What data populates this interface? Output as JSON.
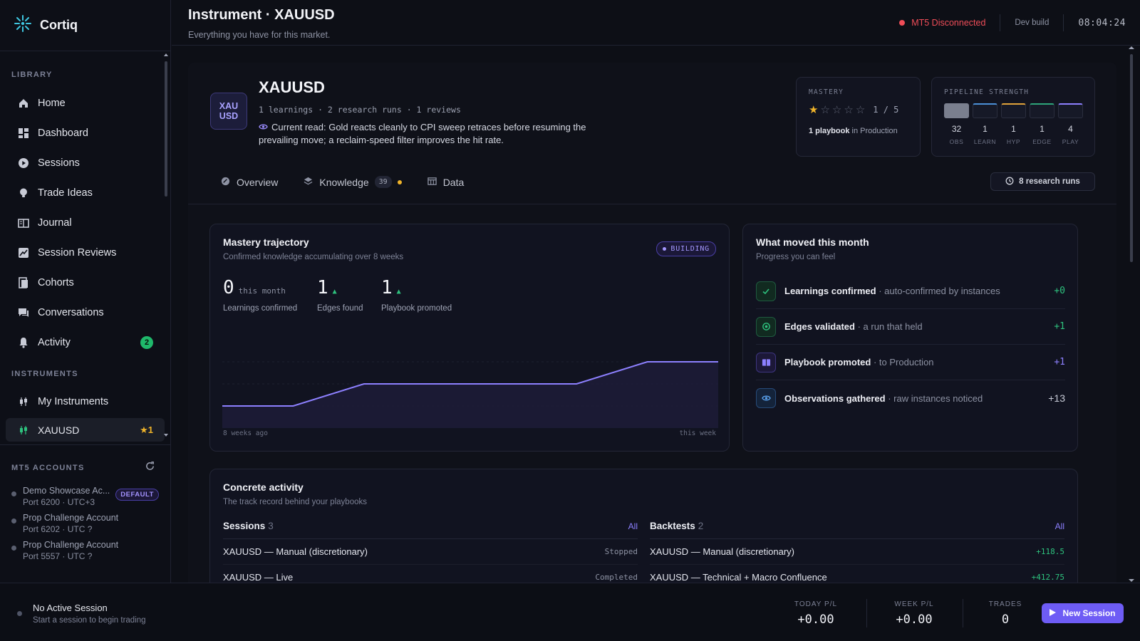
{
  "brand": {
    "name": "Cortiq"
  },
  "sidebar": {
    "library_label": "LIBRARY",
    "items": [
      {
        "label": "Home",
        "icon": "home-icon"
      },
      {
        "label": "Dashboard",
        "icon": "dashboard-icon"
      },
      {
        "label": "Sessions",
        "icon": "play-circle-icon"
      },
      {
        "label": "Trade Ideas",
        "icon": "lightbulb-icon"
      },
      {
        "label": "Journal",
        "icon": "book-icon"
      },
      {
        "label": "Session Reviews",
        "icon": "chart-review-icon"
      },
      {
        "label": "Cohorts",
        "icon": "cohort-icon"
      },
      {
        "label": "Conversations",
        "icon": "chat-icon"
      },
      {
        "label": "Activity",
        "icon": "bell-icon",
        "badge": "2"
      }
    ],
    "instruments_label": "INSTRUMENTS",
    "instruments": [
      {
        "label": "My Instruments",
        "icon": "candles-icon"
      },
      {
        "label": "XAUUSD",
        "icon": "candles-icon",
        "badge": "★1",
        "active": true
      }
    ],
    "mt5_label": "MT5 ACCOUNTS",
    "accounts": [
      {
        "name": "Demo Showcase Ac...",
        "sub": "Port 6200 · UTC+3",
        "badge": "DEFAULT"
      },
      {
        "name": "Prop Challenge Account",
        "sub": "Port 6202 · UTC ?"
      },
      {
        "name": "Prop Challenge Account",
        "sub": "Port 5557 · UTC ?"
      }
    ]
  },
  "header": {
    "title": "Instrument · XAUUSD",
    "subtitle": "Everything you have for this market.",
    "status": "MT5 Disconnected",
    "build": "Dev build",
    "clock": "08:04:24"
  },
  "instrument": {
    "logo_line1": "XAU",
    "logo_line2": "USD",
    "name": "XAUUSD",
    "meta": "1 learnings · 2 research runs · 1 reviews",
    "read": "Current read: Gold reacts cleanly to CPI sweep retraces before resuming the prevailing move; a reclaim-speed filter improves the hit rate.",
    "mastery": {
      "label": "MASTERY",
      "stars_filled": 1,
      "stars_total": 5,
      "ratio": "1 / 5",
      "playbook_count": "1 playbook",
      "playbook_suffix": "in Production"
    },
    "pipeline": {
      "label": "PIPELINE STRENGTH",
      "stages": [
        {
          "value": "32",
          "label": "OBS",
          "color": "#7a7f8e",
          "fill": 1.0
        },
        {
          "value": "1",
          "label": "LEARN",
          "color": "#4b8fd6",
          "fill": 0.1
        },
        {
          "value": "1",
          "label": "HYP",
          "color": "#e0a33a",
          "fill": 0.1
        },
        {
          "value": "1",
          "label": "EDGE",
          "color": "#2ea57a",
          "fill": 0.1
        },
        {
          "value": "4",
          "label": "PLAY",
          "color": "#8d80ff",
          "fill": 0.12
        }
      ]
    },
    "research_button": "8 research runs",
    "tabs": [
      {
        "label": "Overview",
        "icon": "overview-icon"
      },
      {
        "label": "Knowledge",
        "icon": "layers-icon",
        "count": "39",
        "dot": true
      },
      {
        "label": "Data",
        "icon": "table-icon"
      }
    ]
  },
  "trajectory": {
    "title": "Mastery trajectory",
    "subtitle": "Confirmed knowledge accumulating over 8 weeks",
    "badge": "BUILDING",
    "stats": [
      {
        "value": "0",
        "suffix": "this month",
        "label": "Learnings confirmed"
      },
      {
        "value": "1",
        "suffix": "▲",
        "label": "Edges found"
      },
      {
        "value": "1",
        "suffix": "▲",
        "label": "Playbook promoted"
      }
    ],
    "x_start": "8 weeks ago",
    "x_end": "this week"
  },
  "chart_data": {
    "type": "area",
    "x": [
      "8 weeks ago",
      "",
      "",
      "",
      "",
      "",
      "",
      "this week"
    ],
    "values": [
      1,
      1,
      2,
      2,
      2,
      2,
      3,
      3
    ],
    "ylim": [
      0,
      4
    ],
    "grid": false,
    "color": "#8d80ff"
  },
  "moved": {
    "title": "What moved this month",
    "subtitle": "Progress you can feel",
    "rows": [
      {
        "title": "Learnings confirmed",
        "desc": "· auto-confirmed by instances",
        "value": "+0",
        "color": "#2ec27e",
        "icon": "check-icon"
      },
      {
        "title": "Edges validated",
        "desc": "· a run that held",
        "value": "+1",
        "color": "#2ec27e",
        "icon": "target-icon"
      },
      {
        "title": "Playbook promoted",
        "desc": "· to Production",
        "value": "+1",
        "color": "#8d80ff",
        "icon": "playbook-icon"
      },
      {
        "title": "Observations gathered",
        "desc": "· raw instances noticed",
        "value": "+13",
        "color": "#c7cad6",
        "icon": "eye-icon"
      }
    ]
  },
  "activity": {
    "title": "Concrete activity",
    "subtitle": "The track record behind your playbooks",
    "sessions": {
      "title": "Sessions",
      "count": "3",
      "all": "All",
      "rows": [
        {
          "name": "XAUUSD — Manual (discretionary)",
          "status": "Stopped"
        },
        {
          "name": "XAUUSD — Live",
          "status": "Completed"
        }
      ]
    },
    "backtests": {
      "title": "Backtests",
      "count": "2",
      "all": "All",
      "rows": [
        {
          "name": "XAUUSD — Manual (discretionary)",
          "pnl": "+118.5"
        },
        {
          "name": "XAUUSD — Technical + Macro Confluence",
          "pnl": "+412.75"
        }
      ]
    }
  },
  "footer": {
    "session_title": "No Active Session",
    "session_sub": "Start a session to begin trading",
    "today_label": "TODAY P/L",
    "today_value": "+0.00",
    "week_label": "WEEK P/L",
    "week_value": "+0.00",
    "trades_label": "TRADES",
    "trades_value": "0",
    "new_session": "New Session"
  }
}
